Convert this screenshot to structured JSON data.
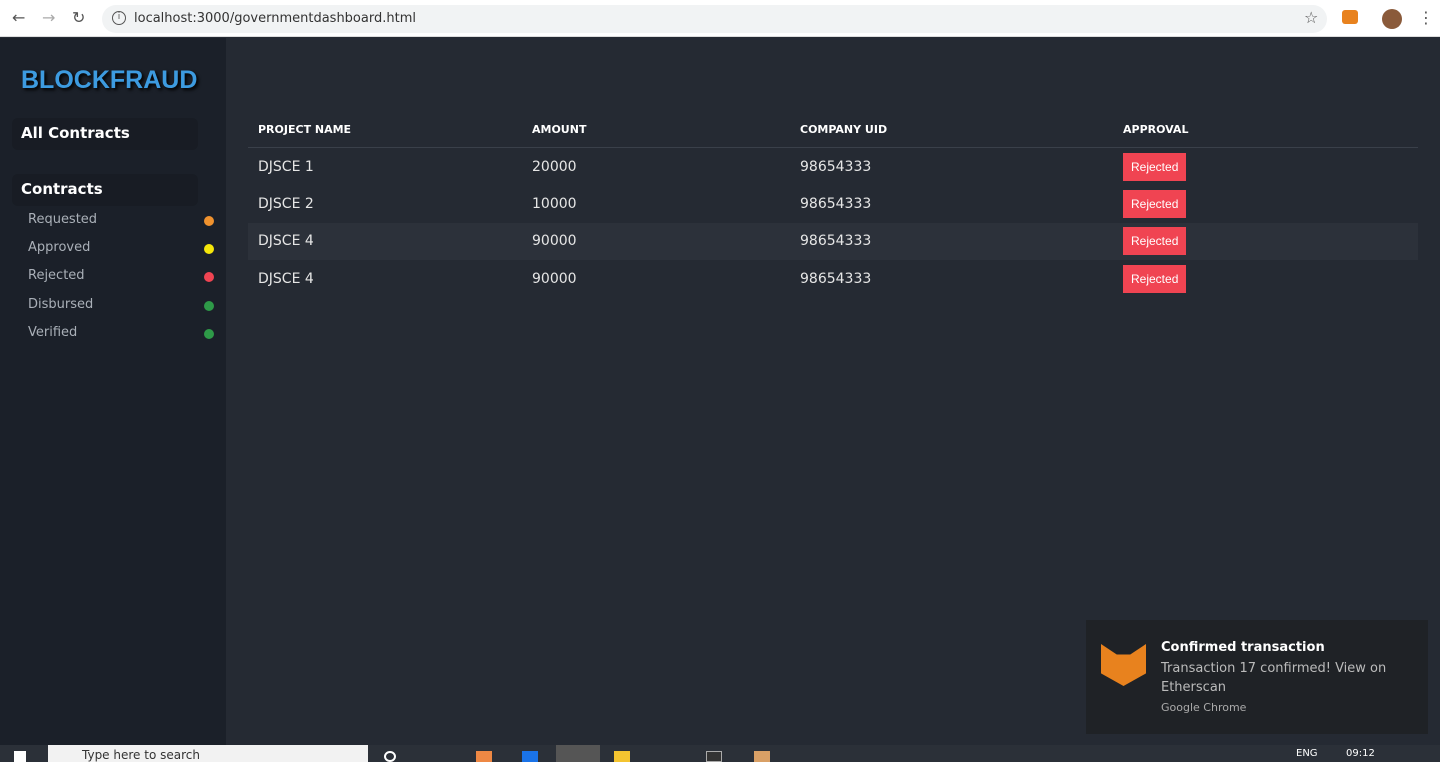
{
  "browser": {
    "url": "localhost:3000/governmentdashboard.html"
  },
  "sidebar": {
    "brand": "BLOCKFRAUD",
    "all_contracts": "All Contracts",
    "contracts": "Contracts",
    "items": [
      {
        "label": "Requested",
        "color": "#f0922e"
      },
      {
        "label": "Approved",
        "color": "#f5e60a"
      },
      {
        "label": "Rejected",
        "color": "#f04452"
      },
      {
        "label": "Disbursed",
        "color": "#2e9a48"
      },
      {
        "label": "Verified",
        "color": "#2e9a48"
      }
    ]
  },
  "table": {
    "headers": [
      "PROJECT NAME",
      "AMOUNT",
      "COMPANY UID",
      "APPROVAL"
    ],
    "rows": [
      [
        "DJSCE 1",
        "20000",
        "98654333",
        "Rejected"
      ],
      [
        "DJSCE 2",
        "10000",
        "98654333",
        "Rejected"
      ],
      [
        "DJSCE 4",
        "90000",
        "98654333",
        "Rejected"
      ],
      [
        "DJSCE 4",
        "90000",
        "98654333",
        "Rejected"
      ]
    ]
  },
  "notification": {
    "title": "Confirmed transaction",
    "message": "Transaction 17 confirmed! View on Etherscan",
    "source": "Google Chrome"
  },
  "taskbar": {
    "search_placeholder": "Type here to search",
    "lang": "ENG",
    "time": "09:12"
  }
}
